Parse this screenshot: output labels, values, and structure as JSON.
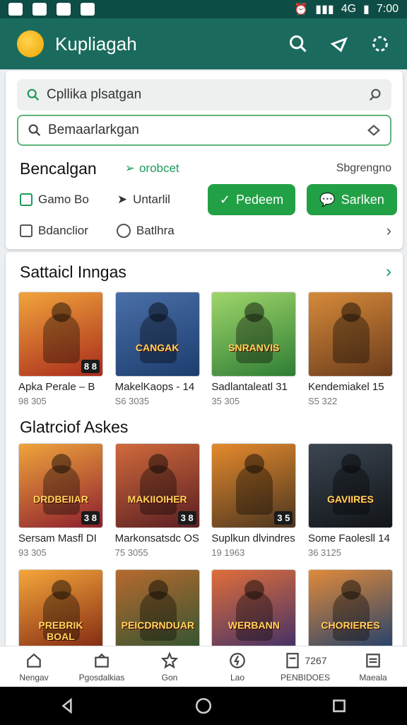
{
  "status": {
    "time": "7:00",
    "network": "4G"
  },
  "app": {
    "title": "Kupliagah"
  },
  "search": {
    "primary_value": "Cpllika plsatgan",
    "secondary_value": "Bemaarlarkgan"
  },
  "filters": {
    "heading": "Bencalgan",
    "link": "orobcet",
    "right_label": "Sbgrengno",
    "option1": "Gamo Bo",
    "option2": "Untarlil",
    "btn1": "Pedeem",
    "btn2": "Sarlken",
    "option3": "Bdanclior",
    "option4": "Batlhra"
  },
  "sections": [
    {
      "title": "Sattaicl Inngas",
      "items": [
        {
          "name": "Apka Perale – B",
          "meta": "98 305",
          "badge": "8 8",
          "banner": "",
          "color1": "#a82b1c",
          "color2": "#f1a43b"
        },
        {
          "name": "MakelKaops - 14",
          "meta": "S6 3035",
          "badge": "",
          "banner": "CANGAK",
          "color1": "#1c3d6e",
          "color2": "#4a6fa8"
        },
        {
          "name": "Sadlantaleatl 31",
          "meta": "35 305",
          "badge": "",
          "banner": "SNRANVIS",
          "color1": "#2f7d35",
          "color2": "#9fd66a"
        },
        {
          "name": "Kendemiakel 15",
          "meta": "S5 322",
          "badge": "",
          "banner": "",
          "color1": "#6b3c1c",
          "color2": "#d68a3a"
        }
      ]
    },
    {
      "title": "Glatrciof Askes",
      "items": [
        {
          "name": "Sersam Masfl DI",
          "meta": "93 305",
          "badge": "3 8",
          "banner": "DRDBEIIAR",
          "color1": "#8c1f2e",
          "color2": "#f0a43b"
        },
        {
          "name": "Markonsatsdc OS",
          "meta": "75 3055",
          "badge": "3 8",
          "banner": "MAKIIOIHER",
          "color1": "#5a1e22",
          "color2": "#d06a3c"
        },
        {
          "name": "Suplkun dlvindres",
          "meta": "19 1963",
          "badge": "3 5",
          "banner": "",
          "color1": "#4a3520",
          "color2": "#e58a2c"
        },
        {
          "name": "Some Faolesll 14",
          "meta": "36 3125",
          "badge": "",
          "banner": "GAVIIRES",
          "color1": "#111418",
          "color2": "#3c4652"
        }
      ]
    },
    {
      "title": "",
      "items": [
        {
          "name": "",
          "meta": "",
          "badge": "",
          "banner": "PREBRIK BOAL",
          "color1": "#7c2412",
          "color2": "#f6a63a"
        },
        {
          "name": "",
          "meta": "",
          "badge": "",
          "banner": "PEICDRNDUAR",
          "color1": "#2d5330",
          "color2": "#b76a2f"
        },
        {
          "name": "",
          "meta": "",
          "badge": "",
          "banner": "WERBANN",
          "color1": "#3b2e6a",
          "color2": "#e06e3a"
        },
        {
          "name": "",
          "meta": "",
          "badge": "",
          "banner": "CHORIERES",
          "color1": "#1c3e6e",
          "color2": "#e08a3a"
        }
      ]
    }
  ],
  "nav": [
    {
      "label": "Nengav",
      "icon": "home-icon"
    },
    {
      "label": "Pgosdalkias",
      "icon": "box-icon"
    },
    {
      "label": "Gon",
      "icon": "star-icon"
    },
    {
      "label": "Lao",
      "icon": "bolt-icon"
    },
    {
      "label": "PENBIDOES",
      "icon": "document-icon",
      "sub": "7267"
    },
    {
      "label": "Maeala",
      "icon": "menu-icon"
    }
  ]
}
